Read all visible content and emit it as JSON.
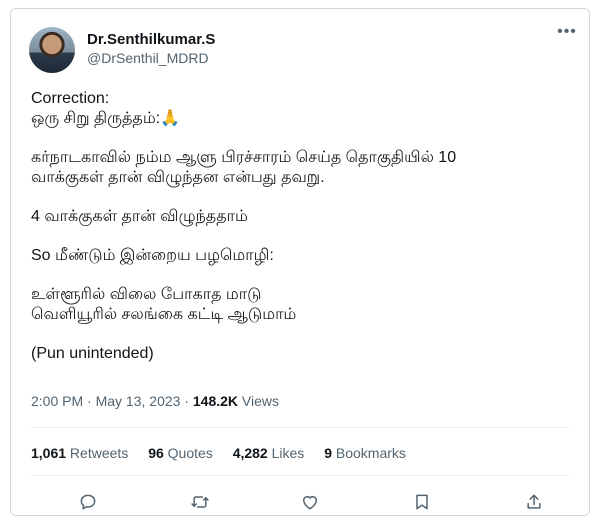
{
  "author": {
    "name": "Dr.Senthilkumar.S",
    "handle": "@DrSenthil_MDRD"
  },
  "tweet": {
    "paragraphs": [
      [
        "Correction:",
        "ஒரு சிறு திருத்தம்:🙏"
      ],
      [
        "கர்நாடகாவில் நம்ம ஆளு பிரச்சாரம் செய்த தொகுதியில் 10",
        "வாக்குகள் தான் விழுந்தன என்பது தவறு."
      ],
      [
        "4 வாக்குகள் தான் விழுந்ததாம்"
      ],
      [
        "So மீண்டும் இன்றைய பழமொழி:"
      ],
      [
        "உள்ளூரில் விலை போகாத மாடு",
        "வெளியூரில் சலங்கை கட்டி ஆடுமாம்"
      ],
      [
        "(Pun unintended)"
      ]
    ]
  },
  "meta": {
    "time": "2:00 PM",
    "dot": " · ",
    "date": "May 13, 2023",
    "views_count": "148.2K",
    "views_label": " Views"
  },
  "stats": {
    "retweets_count": "1,061",
    "retweets_label": " Retweets",
    "quotes_count": "96",
    "quotes_label": " Quotes",
    "likes_count": "4,282",
    "likes_label": " Likes",
    "bookmarks_count": "9",
    "bookmarks_label": " Bookmarks"
  },
  "icons": {
    "more": "more-icon",
    "reply": "reply-icon",
    "retweet": "retweet-icon",
    "like": "heart-icon",
    "bookmark": "bookmark-icon",
    "share": "share-icon"
  },
  "colors": {
    "text": "#0f1419",
    "secondary": "#536471",
    "border": "#cfd9de"
  }
}
